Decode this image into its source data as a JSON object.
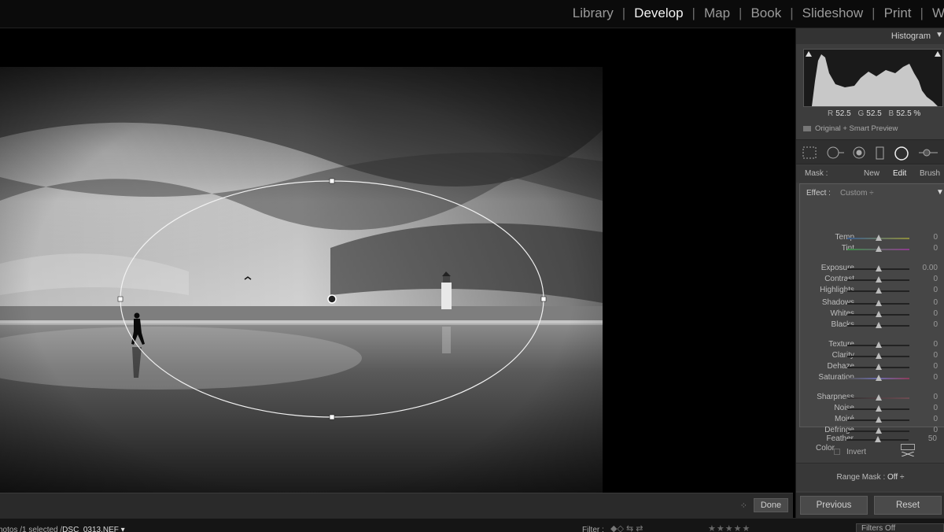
{
  "modules": [
    "Library",
    "Develop",
    "Map",
    "Book",
    "Slideshow",
    "Print",
    "W"
  ],
  "active_module": "Develop",
  "panel": {
    "histogram_title": "Histogram",
    "rgb": {
      "r_label": "R",
      "r": "52.5",
      "g_label": "G",
      "g": "52.5",
      "b_label": "B",
      "b": "52.5 %"
    },
    "preview_label": "Original + Smart Preview",
    "mask": {
      "label": "Mask :",
      "new": "New",
      "edit": "Edit",
      "brush": "Brush"
    },
    "effect": {
      "label": "Effect :",
      "preset": "Custom ÷"
    },
    "sliders": [
      {
        "name": "Temp",
        "value": "0",
        "pos": 0.5
      },
      {
        "name": "Tint",
        "value": "0",
        "pos": 0.5
      },
      {
        "name": "Exposure",
        "value": "0.00",
        "pos": 0.5
      },
      {
        "name": "Contrast",
        "value": "0",
        "pos": 0.5
      },
      {
        "name": "Highlights",
        "value": "0",
        "pos": 0.5
      },
      {
        "name": "Shadows",
        "value": "0",
        "pos": 0.5
      },
      {
        "name": "Whites",
        "value": "0",
        "pos": 0.5
      },
      {
        "name": "Blacks",
        "value": "0",
        "pos": 0.5
      },
      {
        "name": "Texture",
        "value": "0",
        "pos": 0.5
      },
      {
        "name": "Clarity",
        "value": "0",
        "pos": 0.5
      },
      {
        "name": "Dehaze",
        "value": "0",
        "pos": 0.5
      },
      {
        "name": "Saturation",
        "value": "0",
        "pos": 0.5
      },
      {
        "name": "Sharpness",
        "value": "0",
        "pos": 0.5
      },
      {
        "name": "Noise",
        "value": "0",
        "pos": 0.5
      },
      {
        "name": "Moiré",
        "value": "0",
        "pos": 0.5
      },
      {
        "name": "Defringe",
        "value": "0",
        "pos": 0.5
      }
    ],
    "color_label": "Color",
    "feather": {
      "name": "Feather",
      "value": "50",
      "pos": 0.5
    },
    "invert_label": "Invert",
    "range_mask": {
      "label": "Range Mask :",
      "value": "Off ÷"
    },
    "previous_label": "Previous",
    "reset_label": "Reset"
  },
  "toolbar": {
    "done_label": "Done"
  },
  "status": {
    "path_prefix": "hotos /1 selected /",
    "filename": "DSC_0313.NEF ▾",
    "filter_label": "Filter :",
    "filters_off": "Filters Off"
  },
  "colors": {
    "panel": "#3d3d3d",
    "active_text": "#f2f2f2",
    "inactive_text": "#9a9a9a"
  }
}
